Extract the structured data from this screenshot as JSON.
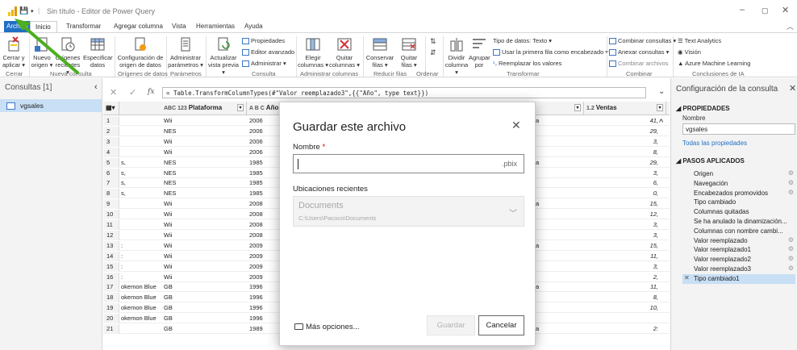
{
  "window": {
    "title": "Sin título - Editor de Power Query",
    "controls": [
      "–",
      "▢",
      "✕"
    ]
  },
  "colors": {
    "accent": "#1f6fc6",
    "arrow": "#4caf1f",
    "brand": "#f2c811"
  },
  "tabs": {
    "archivo": "Archivo",
    "inicio": "Inicio",
    "items": [
      "Transformar",
      "Agregar columna",
      "Vista",
      "Herramientas",
      "Ayuda"
    ]
  },
  "ribbon": {
    "cerrar_aplicar": "Cerrar y aplicar ▾",
    "nuevo_origen": "Nuevo origen ▾",
    "origenes_recientes": "Orígenes recientes ▾",
    "especificar_datos": "Especificar datos",
    "config_origen": "Configuración de origen de datos",
    "admin_parametros": "Administrar parámetros ▾",
    "actualizar": "Actualizar vista previa ▾",
    "propiedades": "Propiedades",
    "editor_avanzado": "Editor avanzado",
    "administrar": "Administrar ▾",
    "elegir_columnas": "Elegir columnas ▾",
    "quitar_columnas": "Quitar columnas ▾",
    "conservar_filas": "Conservar filas ▾",
    "quitar_filas": "Quitar filas ▾",
    "dividir_columna": "Dividir columna ▾",
    "agrupar_por": "Agrupar por",
    "tipo_datos": "Tipo de datos: Texto ▾",
    "primera_fila": "Usar la primera fila como encabezado ▾",
    "reemplazar_valores": "Reemplazar los valores",
    "combinar_consultas": "Combinar consultas ▾",
    "anexar_consultas": "Anexar consultas ▾",
    "combinar_archivos": "Combinar archivos",
    "text_analytics": "Text Analytics",
    "vision": "Visión",
    "azure_ml": "Azure Machine Learning",
    "groups": [
      "Cerrar",
      "Nueva consulta",
      "Orígenes de datos",
      "Parámetros",
      "Consulta",
      "Administrar columnas",
      "Reducir filas",
      "Ordenar",
      "Transformar",
      "Combinar",
      "Conclusiones de IA"
    ]
  },
  "queries": {
    "header": "Consultas [1]",
    "item": "vgsales"
  },
  "formula": {
    "cancel": "✕",
    "commit": "✓",
    "fx": "fx",
    "text": "= Table.TransformColumnTypes(#\"Valor reemplazado3\",{{\"Año\", type text}})"
  },
  "grid": {
    "columns": [
      {
        "type": "ABC 123",
        "name": "Plataforma"
      },
      {
        "type": "A B C",
        "name": "Año"
      },
      {
        "type": "",
        "name": ""
      },
      {
        "type": "1.2",
        "name": "Ventas"
      }
    ],
    "rows": [
      {
        "n": "1",
        "name": "",
        "plat": "Wii",
        "year": "2006",
        "mid": "a",
        "sales": "41,"
      },
      {
        "n": "2",
        "name": "",
        "plat": "NES",
        "year": "2006",
        "mid": "",
        "sales": "29,"
      },
      {
        "n": "3",
        "name": "",
        "plat": "Wii",
        "year": "2006",
        "mid": "",
        "sales": "3,"
      },
      {
        "n": "4",
        "name": "",
        "plat": "Wii",
        "year": "2006",
        "mid": "",
        "sales": "8,"
      },
      {
        "n": "5",
        "name": "s,",
        "plat": "NES",
        "year": "1985",
        "mid": "a",
        "sales": "29,"
      },
      {
        "n": "6",
        "name": "s,",
        "plat": "NES",
        "year": "1985",
        "mid": "",
        "sales": "3,"
      },
      {
        "n": "7",
        "name": "s,",
        "plat": "NES",
        "year": "1985",
        "mid": "",
        "sales": "6,"
      },
      {
        "n": "8",
        "name": "s,",
        "plat": "NES",
        "year": "1985",
        "mid": "",
        "sales": "0,"
      },
      {
        "n": "9",
        "name": "",
        "plat": "Wii",
        "year": "2008",
        "mid": "a",
        "sales": "15,"
      },
      {
        "n": "10",
        "name": "",
        "plat": "Wii",
        "year": "2008",
        "mid": "",
        "sales": "12,"
      },
      {
        "n": "11",
        "name": "",
        "plat": "Wii",
        "year": "2008",
        "mid": "",
        "sales": "3,"
      },
      {
        "n": "12",
        "name": "",
        "plat": "Wii",
        "year": "2008",
        "mid": "",
        "sales": "3,"
      },
      {
        "n": "13",
        "name": ":",
        "plat": "Wii",
        "year": "2009",
        "mid": "a",
        "sales": "15,"
      },
      {
        "n": "14",
        "name": ":",
        "plat": "Wii",
        "year": "2009",
        "mid": "",
        "sales": "11,"
      },
      {
        "n": "15",
        "name": ":",
        "plat": "Wii",
        "year": "2009",
        "mid": "",
        "sales": "3,"
      },
      {
        "n": "16",
        "name": ":",
        "plat": "Wii",
        "year": "2009",
        "mid": "",
        "sales": "2,"
      },
      {
        "n": "17",
        "name": "okemon Blue",
        "plat": "GB",
        "year": "1996",
        "mid": "a",
        "sales": "11,"
      },
      {
        "n": "18",
        "name": "okemon Blue",
        "plat": "GB",
        "year": "1996",
        "mid": "",
        "sales": "8,"
      },
      {
        "n": "19",
        "name": "okemon Blue",
        "plat": "GB",
        "year": "1996",
        "mid": "",
        "sales": "10,"
      },
      {
        "n": "20",
        "name": "okemon Blue",
        "plat": "GB",
        "year": "1996",
        "mid": "",
        "sales": ""
      },
      {
        "n": "21",
        "name": "",
        "plat": "GB",
        "year": "1989",
        "mid": "a",
        "sales": "2:"
      }
    ]
  },
  "settings": {
    "title": "Configuración de la consulta",
    "close": "✕",
    "properties_header": "PROPIEDADES",
    "name_label": "Nombre",
    "name_value": "vgsales",
    "all_props": "Todas las propiedades",
    "steps_header": "PASOS APLICADOS",
    "steps": [
      {
        "label": "Origen",
        "gear": true
      },
      {
        "label": "Navegación",
        "gear": true
      },
      {
        "label": "Encabezados promovidos",
        "gear": true
      },
      {
        "label": "Tipo cambiado",
        "gear": false
      },
      {
        "label": "Columnas quitadas",
        "gear": false
      },
      {
        "label": "Se ha anulado la dinamización...",
        "gear": false
      },
      {
        "label": "Columnas con nombre cambi...",
        "gear": false
      },
      {
        "label": "Valor reemplazado",
        "gear": true
      },
      {
        "label": "Valor reemplazado1",
        "gear": true
      },
      {
        "label": "Valor reemplazado2",
        "gear": true
      },
      {
        "label": "Valor reemplazado3",
        "gear": true
      },
      {
        "label": "Tipo cambiado1",
        "gear": false,
        "active": true
      }
    ]
  },
  "dialog": {
    "title": "Guardar este archivo",
    "close": "✕",
    "name_label": "Nombre",
    "required_mark": "*",
    "name_value": "",
    "extension": ".pbix",
    "recent_label": "Ubicaciones recientes",
    "recent_main": "Documents",
    "recent_path": "C:\\Users\\Pacoco\\Documents",
    "more_options": "Más opciones...",
    "save": "Guardar",
    "cancel": "Cancelar"
  }
}
